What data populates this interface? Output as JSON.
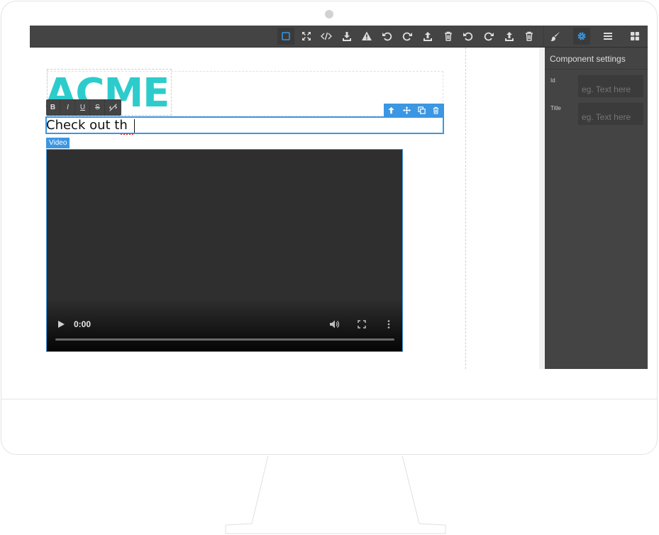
{
  "toolbar": {
    "buttons": [
      {
        "name": "sw-visibility-button",
        "icon": "square-outline-icon",
        "active": true
      },
      {
        "name": "fullscreen-button",
        "icon": "expand-icon"
      },
      {
        "name": "export-code-button",
        "icon": "code-icon"
      },
      {
        "name": "import-button",
        "icon": "download-icon"
      },
      {
        "name": "warning-button",
        "icon": "warning-icon"
      },
      {
        "name": "undo-button",
        "icon": "undo-icon"
      },
      {
        "name": "redo-button",
        "icon": "redo-icon"
      },
      {
        "name": "export-button",
        "icon": "upload-icon"
      },
      {
        "name": "clear-canvas-button",
        "icon": "trash-icon"
      },
      {
        "name": "undo-button-2",
        "icon": "undo-icon"
      },
      {
        "name": "redo-button-2",
        "icon": "redo-icon"
      },
      {
        "name": "export-button-2",
        "icon": "upload-icon"
      },
      {
        "name": "clear-canvas-button-2",
        "icon": "trash-icon"
      }
    ],
    "panels": [
      {
        "name": "style-manager-button",
        "icon": "paintbrush-icon"
      },
      {
        "name": "settings-button",
        "icon": "gear-icon",
        "active": true
      },
      {
        "name": "layer-manager-button",
        "icon": "bars-icon"
      },
      {
        "name": "blocks-button",
        "icon": "grid-icon"
      }
    ],
    "accent_color": "#3b97e3",
    "bg_color": "#444444"
  },
  "canvas": {
    "logo_text": "ACME",
    "logo_color": "#2dcccc",
    "rte_buttons": [
      "B",
      "I",
      "U",
      "S"
    ],
    "text_value": "Check out th",
    "video_badge": "Video",
    "video_time": "0:00"
  },
  "panel": {
    "title": "Component settings",
    "traits": [
      {
        "label": "Id",
        "placeholder": "eg. Text here"
      },
      {
        "label": "Title",
        "placeholder": "eg. Text here"
      }
    ]
  }
}
